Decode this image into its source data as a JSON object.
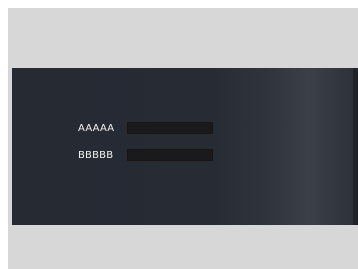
{
  "fields": [
    {
      "label": "AAAAA",
      "value": ""
    },
    {
      "label": "BBBBB",
      "value": ""
    }
  ],
  "colors": {
    "frame": "#d6d6d6",
    "panel": "#262b34",
    "input": "#1a1a1d",
    "label": "#f2f2f2"
  }
}
